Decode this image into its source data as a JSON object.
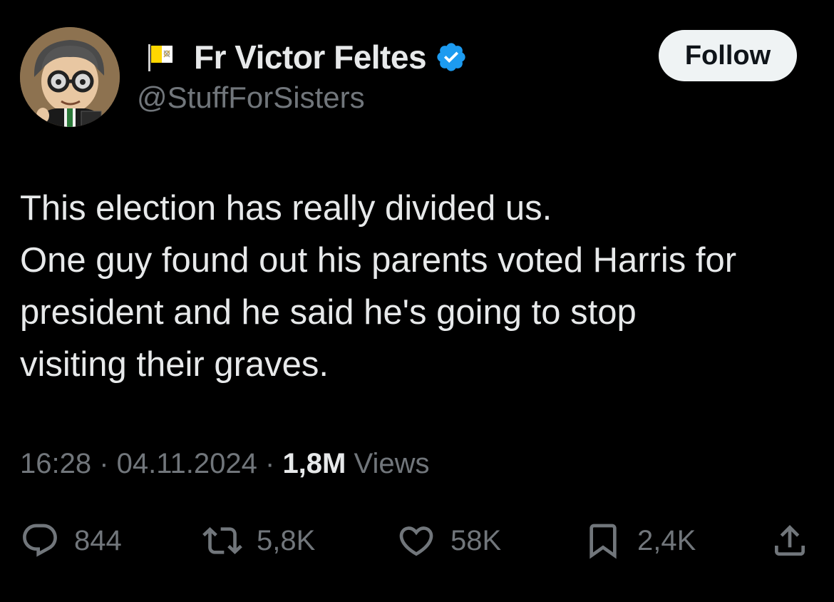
{
  "author": {
    "display_name": "Fr Victor Feltes",
    "handle": "@StuffForSisters",
    "verified_color": "#1d9bf0",
    "flag_icon": "vatican-flag-icon"
  },
  "follow_button": {
    "label": "Follow"
  },
  "tweet": {
    "lines": [
      "This election has really divided us.",
      "One guy found out his parents voted Harris for",
      "president and he said he's going to stop",
      "visiting their graves."
    ]
  },
  "meta": {
    "time": "16:28",
    "separator": " · ",
    "date": "04.11.2024",
    "views_count": "1,8M",
    "views_label": " Views"
  },
  "actions": {
    "replies": "844",
    "reposts": "5,8K",
    "likes": "58K",
    "bookmarks": "2,4K"
  },
  "colors": {
    "background": "#000000",
    "primary_text": "#e7e9ea",
    "secondary_text": "#71767b",
    "follow_bg": "#eff3f4"
  }
}
